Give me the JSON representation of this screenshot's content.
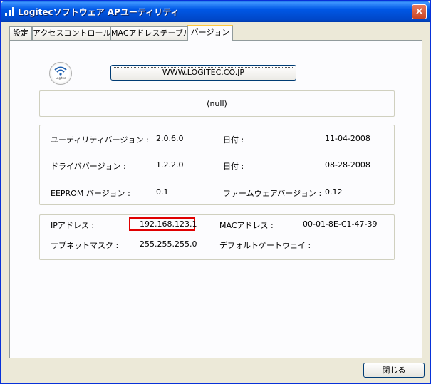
{
  "window": {
    "title": "Logitecソフトウェア APユーティリティ",
    "close_glyph": "×"
  },
  "tabs": [
    {
      "label": "設定",
      "active": false
    },
    {
      "label": "アクセスコントロール",
      "active": false
    },
    {
      "label": "MACアドレステーブル",
      "active": false
    },
    {
      "label": "バージョン",
      "active": true
    }
  ],
  "logo": {
    "icon": "logitec-wifi-logo-icon",
    "text": "Logitec"
  },
  "url_button": {
    "label": "WWW.LOGITEC.CO.JP"
  },
  "status": {
    "text": "(null)"
  },
  "version_info": {
    "utility_version_label": "ユーティリティバージョン :",
    "utility_version_value": "2.0.6.0",
    "utility_date_label": "日付 :",
    "utility_date_value": "11-04-2008",
    "driver_version_label": "ドライババージョン :",
    "driver_version_value": "1.2.2.0",
    "driver_date_label": "日付 :",
    "driver_date_value": "08-28-2008",
    "eeprom_label": "EEPROM バージョン :",
    "eeprom_value": "0.1",
    "firmware_label": "ファームウェアバージョン :",
    "firmware_value": "0.12"
  },
  "network_info": {
    "ip_label": "IPアドレス :",
    "ip_value": "192.168.123.1",
    "mac_label": "MACアドレス :",
    "mac_value": "00-01-8E-C1-47-39",
    "subnet_label": "サブネットマスク :",
    "subnet_value": "255.255.255.0",
    "gateway_label": "デフォルトゲートウェイ :",
    "gateway_value": ""
  },
  "footer": {
    "close_label": "閉じる"
  },
  "colors": {
    "highlight": "#e00000",
    "titlebar": "#0058e6",
    "tab_active_accent": "#ffc83c"
  }
}
